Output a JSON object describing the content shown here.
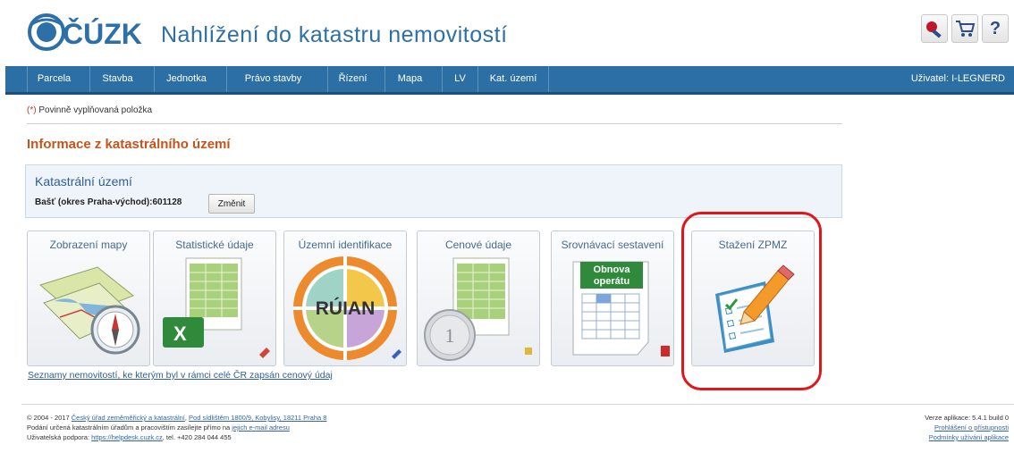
{
  "header": {
    "logo_text": "ČÚZK",
    "app_title": "Nahlížení do katastru nemovitostí",
    "help_label": "?"
  },
  "nav": {
    "items": [
      {
        "label": "Parcela"
      },
      {
        "label": "Stavba"
      },
      {
        "label": "Jednotka"
      },
      {
        "label": "Právo stavby"
      },
      {
        "label": "Řízení"
      },
      {
        "label": "Mapa"
      },
      {
        "label": "LV"
      },
      {
        "label": "Kat. území"
      }
    ],
    "user": "Uživatel: I-LEGNERD"
  },
  "content": {
    "required_star": "(*)",
    "required_text": " Povinně vyplňovaná položka",
    "section_title": "Informace z katastrálního území",
    "ku_title": "Katastrální území",
    "ku_value": "Bašť (okres Praha-východ):601128",
    "change_button": "Změnit",
    "list_link": "Seznamy nemovitostí, ke kterým byl v rámci celé ČR zapsán cenový údaj"
  },
  "tiles": [
    {
      "label": "Zobrazení mapy",
      "icon": "map-compass-icon"
    },
    {
      "label": "Statistické údaje",
      "icon": "spreadsheet-excel-icon"
    },
    {
      "label": "Územní identifikace",
      "icon": "ruian-icon",
      "icon_text": "RÚIAN"
    },
    {
      "label": "Cenové údaje",
      "icon": "price-coin-icon"
    },
    {
      "label": "Srovnávací sestavení",
      "icon": "operat-sheet-icon",
      "badge_line1": "Obnova",
      "badge_line2": "operátu"
    },
    {
      "label": "Stažení ZPMZ",
      "icon": "document-pencil-icon"
    }
  ],
  "footer": {
    "line1_prefix": "© 2004 - 2017 ",
    "line1_link1": "Český úřad zeměměřický a katastrální",
    "line1_sep": ", ",
    "line1_link2": "Pod sídlištěm 1800/9, Kobylisy, 18211 Praha 8",
    "line2_prefix": "Podání určená katastrálním úřadům a pracovištím zasílejte přímo na ",
    "line2_link": "jejich e-mail adresu",
    "line3_prefix": "Uživatelská podpora: ",
    "line3_link": "https://helpdesk.cuzk.cz",
    "line3_suffix": ", tel. +420 284 044 455",
    "version": "Verze aplikace: 5.4.1 build 0",
    "login_link": "Prohlášení o přístupnosti",
    "terms_link": "Podmínky užívání aplikace"
  },
  "colors": {
    "nav_bg": "#2b6fa5",
    "section_title": "#c4541d",
    "highlight": "#e0161b"
  }
}
